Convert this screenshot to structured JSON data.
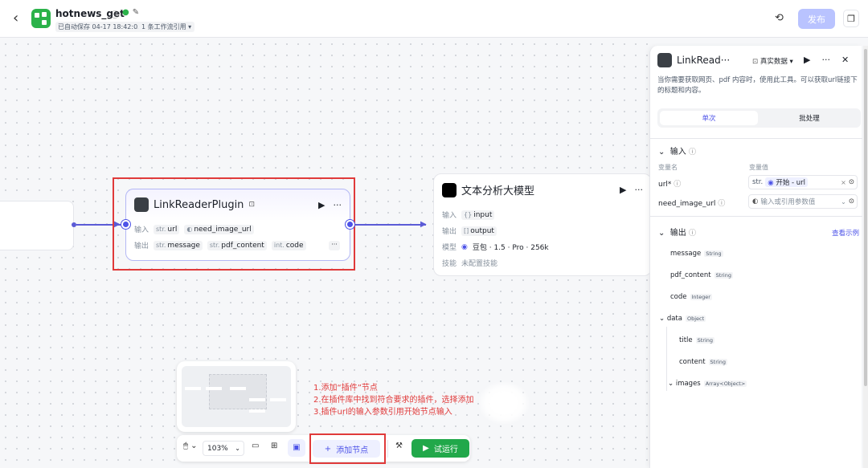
{
  "header": {
    "title": "hotnews_get",
    "saved_status": "已自动保存 04-17 18:42:05",
    "workflow_refs": "1 条工作流引用",
    "publish_label": "发布"
  },
  "plugin_node": {
    "title": "LinkReaderPlugin",
    "input_label": "输入",
    "output_label": "输出",
    "inputs": [
      {
        "type": "str.",
        "name": "url"
      },
      {
        "type": "toggle",
        "name": "need_image_url"
      }
    ],
    "outputs": [
      {
        "type": "str.",
        "name": "message"
      },
      {
        "type": "str.",
        "name": "pdf_content"
      },
      {
        "type": "int.",
        "name": "code"
      }
    ],
    "more": "···"
  },
  "llm_node": {
    "title": "文本分析大模型",
    "input_label": "输入",
    "input_value": "input",
    "output_label": "输出",
    "output_value": "output",
    "model_label": "模型",
    "model_value": "豆包 · 1.5 · Pro · 256k",
    "skill_label": "技能",
    "skill_value": "未配置技能"
  },
  "panel": {
    "title": "LinkRead···",
    "data_mode": "真实数据",
    "description": "当你需要获取网页、pdf 内容时，使用此工具。可以获取url链接下的标题和内容。",
    "tab_single": "单次",
    "tab_batch": "批处理",
    "input_section": "输入",
    "col_name": "变量名",
    "col_value": "变量值",
    "url_label": "url*",
    "url_value": "开始 - url",
    "url_type": "str.",
    "need_image_label": "need_image_url",
    "need_image_placeholder": "输入或引用参数值",
    "output_section": "输出",
    "view_example": "查看示例",
    "outputs": [
      {
        "name": "message",
        "type": "String"
      },
      {
        "name": "pdf_content",
        "type": "String"
      },
      {
        "name": "code",
        "type": "Integer"
      },
      {
        "name": "data",
        "type": "Object"
      },
      {
        "name": "title",
        "type": "String"
      },
      {
        "name": "content",
        "type": "String"
      },
      {
        "name": "images",
        "type": "Array<Object>"
      }
    ]
  },
  "annotation": {
    "line1": "1.添加“插件”节点",
    "line2": "2.在插件库中找到符合要求的插件，选择添加",
    "line3": "3.插件url的输入参数引用开始节点输入"
  },
  "toolbar": {
    "zoom": "103%",
    "add_node": "添加节点",
    "run": "试运行"
  },
  "colors": {
    "accent": "#4d53e8",
    "run_green": "#21a84a",
    "highlight_red": "#e03a3a"
  }
}
